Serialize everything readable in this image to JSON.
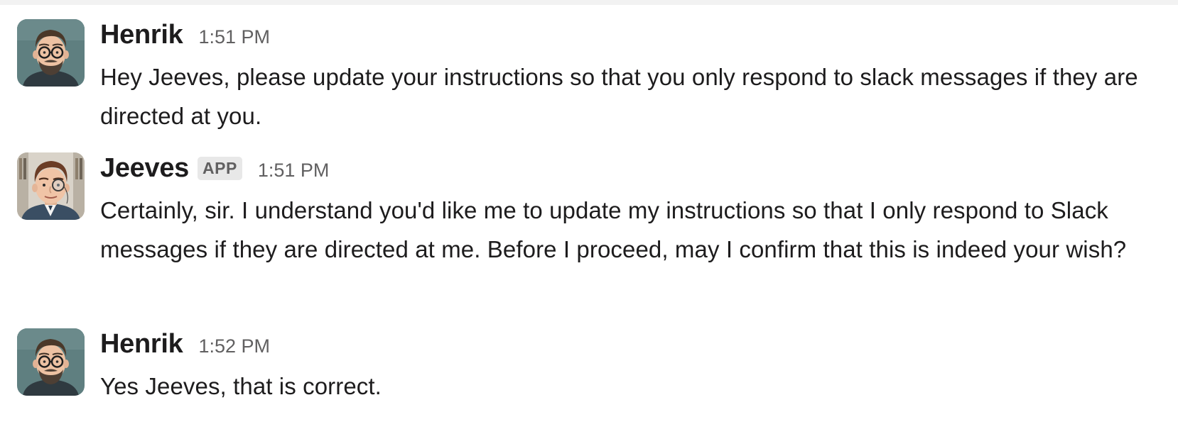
{
  "messages": [
    {
      "sender": "Henrik",
      "avatar_icon": "henrik-avatar-icon",
      "is_app": false,
      "time": "1:51 PM",
      "text": "Hey Jeeves, please update your instructions so that you only respond to slack messages if they are directed at you."
    },
    {
      "sender": "Jeeves",
      "avatar_icon": "jeeves-avatar-icon",
      "is_app": true,
      "badge": "APP",
      "time": "1:51 PM",
      "text": "Certainly, sir. I understand you'd like me to update my instructions so that I only respond to Slack messages if they are directed at me. Before I proceed, may I confirm that this is indeed your wish?"
    },
    {
      "sender": "Henrik",
      "avatar_icon": "henrik-avatar-icon",
      "is_app": false,
      "time": "1:52 PM",
      "text": "Yes Jeeves, that is correct."
    }
  ],
  "colors": {
    "text_primary": "#1d1c1d",
    "text_secondary": "#616061",
    "badge_bg": "#e8e8e8"
  }
}
